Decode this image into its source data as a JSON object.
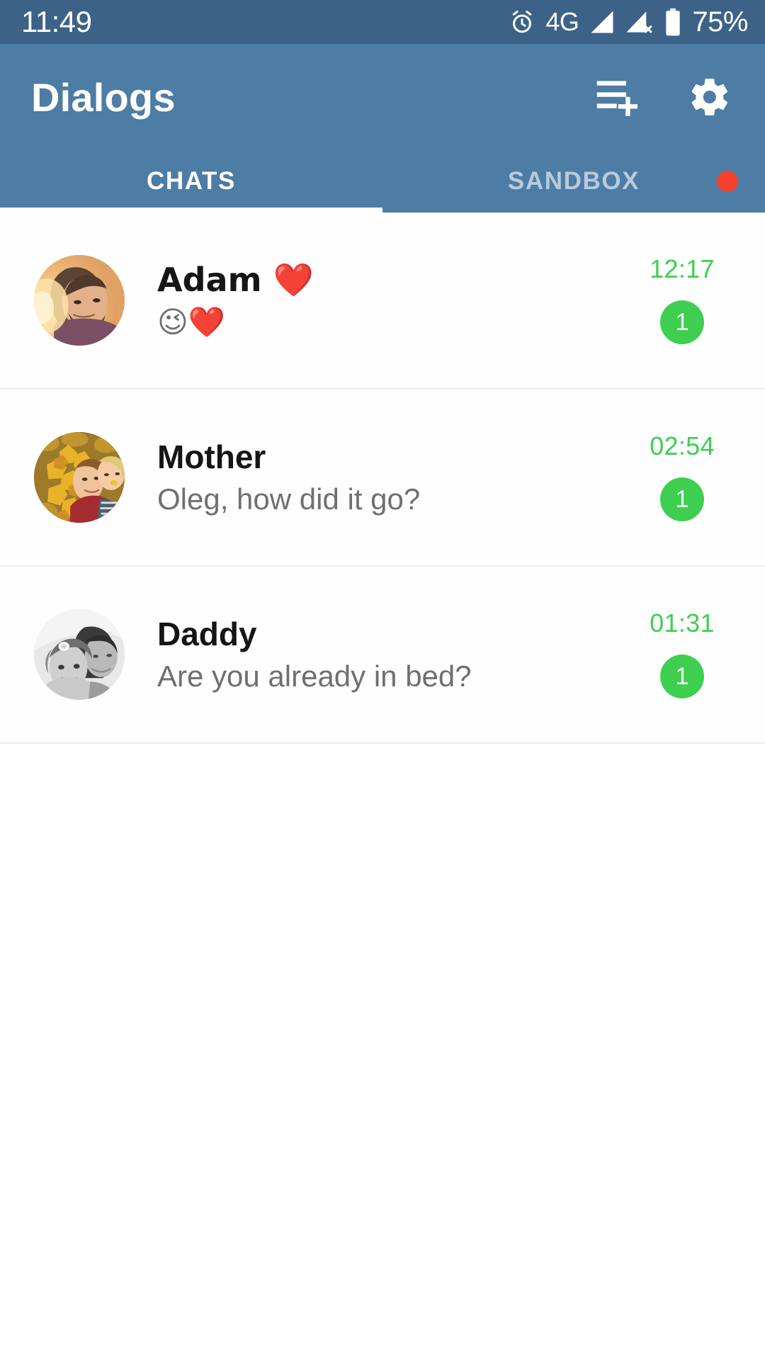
{
  "status_bar": {
    "time": "11:49",
    "network_type": "4G",
    "battery_percent": "75%",
    "icons": {
      "alarm": "alarm-clock-icon",
      "signal_sim1": "signal-bars-icon",
      "signal_sim2": "signal-bars-no-service-icon",
      "battery": "battery-icon"
    },
    "colors": {
      "background": "#3c6287",
      "foreground": "#ffffff"
    }
  },
  "app_bar": {
    "title": "Dialogs",
    "background": "#4d7ca5",
    "actions": [
      {
        "name": "new-chat-button",
        "icon": "playlist-add-icon"
      },
      {
        "name": "settings-button",
        "icon": "gear-icon"
      }
    ]
  },
  "tabs": {
    "active_index": 0,
    "indicator_color": "#ffffff",
    "items": [
      {
        "label": "CHATS",
        "active": true,
        "badge": false
      },
      {
        "label": "SANDBOX",
        "active": false,
        "badge": true,
        "badge_color": "#f4402e"
      }
    ]
  },
  "chat_list": {
    "accent_color": "#3ecf50",
    "rows": [
      {
        "name": "Adam ❤️",
        "preview": "😉❤️",
        "time": "12:17",
        "unread": "1",
        "avatar": "photo-bearded-man-sunlight"
      },
      {
        "name": "Mother",
        "preview": "Oleg, how did it go?",
        "time": "02:54",
        "unread": "1",
        "avatar": "photo-woman-child-autumn-leaves"
      },
      {
        "name": "Daddy",
        "preview": "Are you already in bed?",
        "time": "01:31",
        "unread": "1",
        "avatar": "photo-father-daughter-black-white"
      }
    ]
  }
}
